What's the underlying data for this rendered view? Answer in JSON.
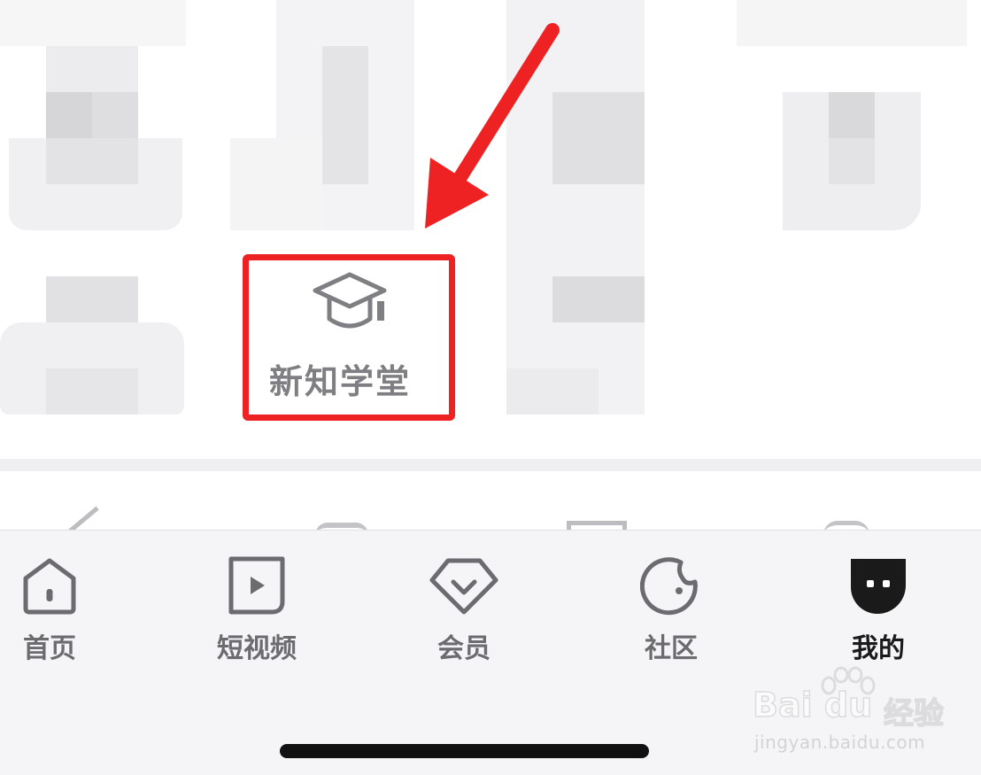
{
  "featured_tile": {
    "label": "新知学堂",
    "icon": "graduation-cap-icon"
  },
  "tabbar": {
    "tabs": [
      {
        "label": "首页",
        "icon": "home-icon",
        "active": false
      },
      {
        "label": "短视频",
        "icon": "play-icon",
        "active": false
      },
      {
        "label": "会员",
        "icon": "diamond-icon",
        "active": false
      },
      {
        "label": "社区",
        "icon": "community-icon",
        "active": false
      },
      {
        "label": "我的",
        "icon": "profile-icon",
        "active": true
      }
    ]
  },
  "watermark": {
    "brand": "Bai du",
    "product": "经验",
    "url": "jingyan.baidu.com"
  },
  "colors": {
    "highlight": "#ee2222",
    "tab_inactive": "#6c6c70",
    "tab_active": "#1a1a1a",
    "tabbar_bg": "#f5f5f7"
  }
}
